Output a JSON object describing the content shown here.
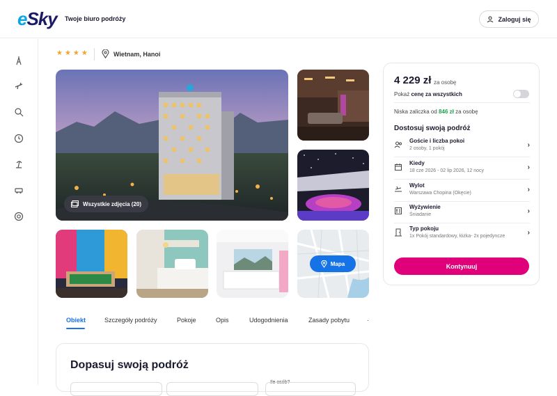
{
  "header": {
    "logo": "Sky",
    "logo_prefix": "e",
    "tagline": "Twoje biuro podróży",
    "login_label": "Zaloguj się"
  },
  "hotel": {
    "stars": "★★★★",
    "location": "Wietnam, Hanoi"
  },
  "gallery": {
    "all_photos_label": "Wszystkie zdjęcia (20)",
    "map_label": "Mapa"
  },
  "tabs": [
    {
      "label": "Obiekt",
      "active": true
    },
    {
      "label": "Szczegóły podróży"
    },
    {
      "label": "Pokoje"
    },
    {
      "label": "Opis"
    },
    {
      "label": "Udogodnienia"
    },
    {
      "label": "Zasady pobytu"
    },
    {
      "label": "·"
    }
  ],
  "booking": {
    "price": "4 229 zł",
    "per_person": "za osobę",
    "show_all_prefix": "Pokaż",
    "show_all_bold": "cenę za wszystkich",
    "deposit_prefix": "Niska zaliczka od",
    "deposit_amount": "846 zł",
    "deposit_suffix": "za osobę",
    "customize_title": "Dostosuj swoją podróż",
    "rows": [
      {
        "title": "Goście i liczba pokoi",
        "sub": "2 osoby, 1 pokój",
        "icon": "users-icon"
      },
      {
        "title": "Kiedy",
        "sub": "18 cze 2026 - 02 lip 2026, 12 nocy",
        "icon": "calendar-icon"
      },
      {
        "title": "Wylot",
        "sub": "Warszawa Chopina (Okęcie)",
        "icon": "plane-icon"
      },
      {
        "title": "Wyżywienie",
        "sub": "Śniadanie",
        "icon": "meal-icon"
      },
      {
        "title": "Typ pokoju",
        "sub": "1x Pokój standardowy, łóżka- 2x pojedyncze",
        "icon": "door-icon"
      }
    ],
    "cta": "Kontynuuj"
  },
  "bottom": {
    "title": "Dopasuj swoją podróż",
    "guests_label": "Ile osób?"
  },
  "colors": {
    "accent": "#1673e6",
    "cta": "#e0007a",
    "deposit": "#1aa34a",
    "stars": "#f2a32c"
  }
}
